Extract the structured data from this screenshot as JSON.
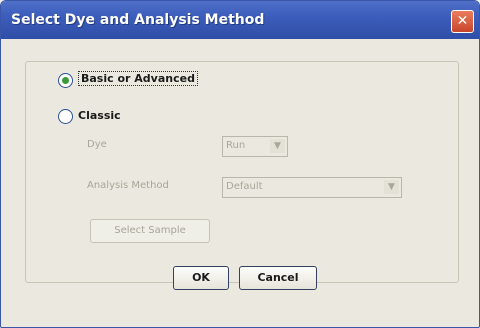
{
  "window": {
    "title": "Select Dye and Analysis Method",
    "close_glyph": "✕"
  },
  "options": {
    "basic": {
      "label": "Basic or Advanced",
      "selected": true
    },
    "classic": {
      "label": "Classic",
      "selected": false
    }
  },
  "classic_settings": {
    "dye_label": "Dye",
    "dye_value": "Run",
    "analysis_label": "Analysis Method",
    "analysis_value": "Default",
    "select_sample_label": "Select Sample"
  },
  "buttons": {
    "ok_label": "OK",
    "cancel_label": "Cancel"
  },
  "icons": {
    "dropdown_arrow": "▼",
    "close": "close-icon"
  },
  "colors": {
    "titlebar": "#3c5dbb",
    "close_button": "#d9573b",
    "radio_dot": "#3a9a3a"
  }
}
